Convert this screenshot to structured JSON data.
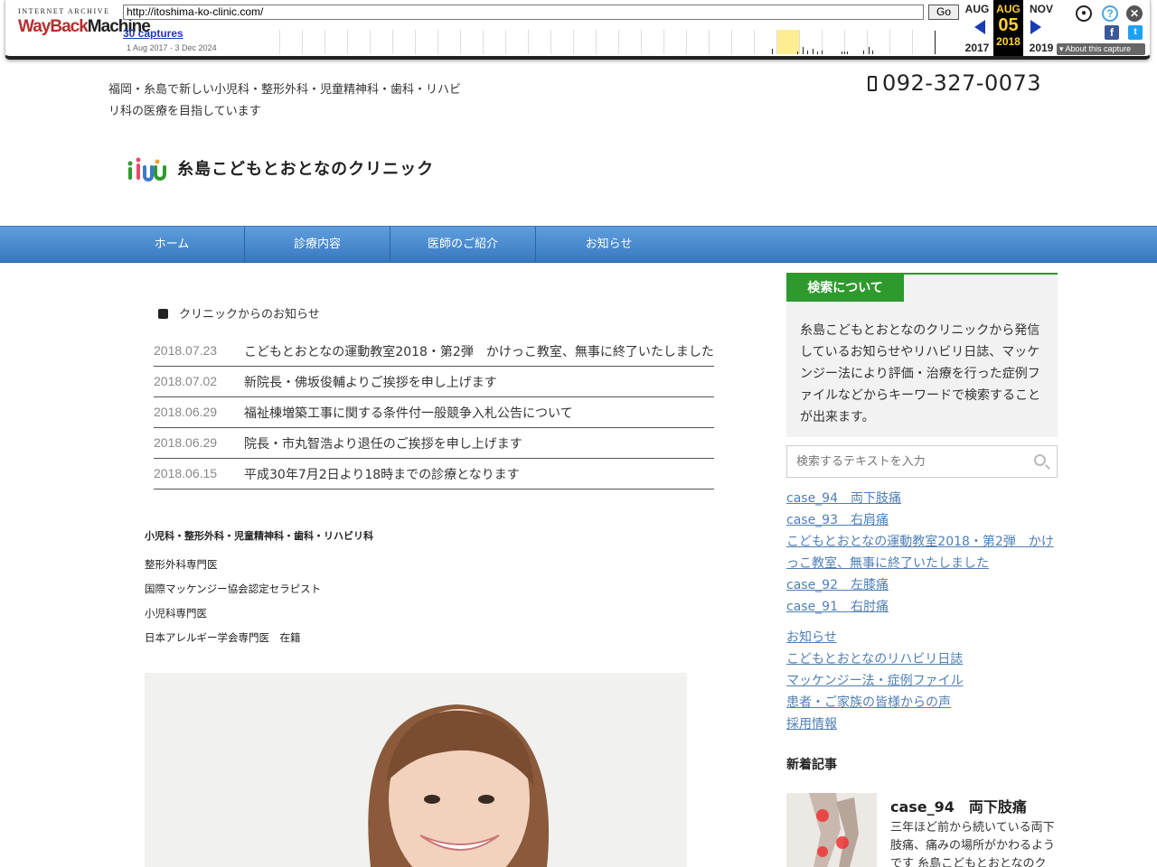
{
  "wayback": {
    "logo_top": "INTERNET ARCHIVE",
    "logo_way": "WayBack",
    "logo_machine": "Machine",
    "url": "http://itoshima-ko-clinic.com/",
    "go_label": "Go",
    "captures": "30 captures",
    "range": "1 Aug 2017 - 3 Dec 2024",
    "prev_month": "AUG",
    "prev_year": "2017",
    "cur_month": "AUG",
    "cur_day": "05",
    "cur_year": "2018",
    "next_month": "NOV",
    "next_year": "2019",
    "about": "About this capture"
  },
  "header": {
    "tagline": "福岡・糸島で新しい小児科・整形外科・児童精神科・歯科・リハビリ科の医療を目指しています",
    "phone": "092-327-0073",
    "clinic_name": "糸島こどもとおとなのクリニック"
  },
  "nav": {
    "items": [
      {
        "label": "ホーム"
      },
      {
        "label": "診療内容"
      },
      {
        "label": "医師のご紹介"
      },
      {
        "label": "お知らせ"
      }
    ]
  },
  "news": {
    "heading": "クリニックからのお知らせ",
    "items": [
      {
        "date": "2018.07.23",
        "title": "こどもとおとなの運動教室2018・第2弾　かけっこ教室、無事に終了いたしました"
      },
      {
        "date": "2018.07.02",
        "title": "新院長・佛坂俊輔よりご挨拶を申し上げます"
      },
      {
        "date": "2018.06.29",
        "title": "福祉棟増築工事に関する条件付一般競争入札公告について"
      },
      {
        "date": "2018.06.29",
        "title": "院長・市丸智浩より退任のご挨拶を申し上げます"
      },
      {
        "date": "2018.06.15",
        "title": "平成30年7月2日より18時までの診療となります"
      }
    ]
  },
  "intro": {
    "heading": "小児科・整形外科・児童精神科・歯科・リハビリ科",
    "lines": [
      "整形外科専門医",
      "国際マッケンジー協会認定セラピスト",
      "小児科専門医",
      "日本アレルギー学会専門医　在籍"
    ]
  },
  "sidebar": {
    "search_tab": "検索について",
    "search_desc": "糸島こどもとおとなのクリニックから発信しているお知らせやリハビリ日誌、マッケンジー法により評価・治療を行った症例ファイルなどからキーワードで検索することが出来ます。",
    "search_placeholder": "検索するテキストを入力",
    "recent_links": [
      "case_94　両下肢痛",
      "case_93　右肩痛",
      "こどもとおとなの運動教室2018・第2弾　かけっこ教室、無事に終了いたしました",
      "case_92　左膝痛",
      "case_91　右肘痛"
    ],
    "category_links": [
      "お知らせ",
      "こどもとおとなのリハビリ日誌",
      "マッケンジー法・症例ファイル",
      "患者・ご家族の皆様からの声",
      "採用情報"
    ],
    "newest_heading": "新着記事",
    "newest_post_title": "case_94　両下肢痛",
    "newest_post_excerpt": "三年ほど前から続いている両下肢痛、痛みの場所がかわるようです 糸島こどもとおとなのク"
  },
  "colors": {
    "nav_blue": "#3778c0",
    "accent_green": "#2e9a2e",
    "link_blue": "#4f7fb5"
  }
}
